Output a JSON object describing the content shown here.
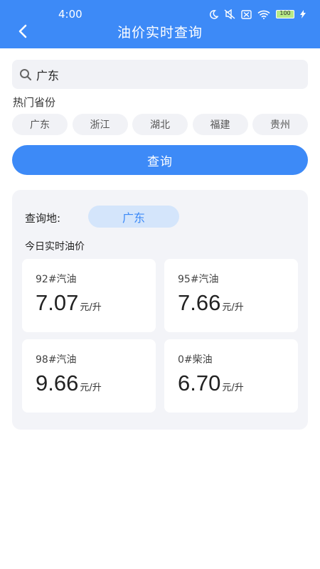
{
  "status_bar": {
    "time": "4:00",
    "battery": "100",
    "icons": [
      "moon-icon",
      "mute-icon",
      "sim-off-icon",
      "wifi-icon",
      "battery-icon",
      "charging-icon"
    ]
  },
  "header": {
    "title": "油价实时查询",
    "back_icon": "chevron-left-icon"
  },
  "search": {
    "value": "广东",
    "icon": "search-icon"
  },
  "hot_provinces": {
    "label": "热门省份",
    "items": [
      "广东",
      "浙江",
      "湖北",
      "福建",
      "贵州"
    ]
  },
  "query_button": {
    "label": "查询"
  },
  "result": {
    "location_label": "查询地:",
    "location_value": "广东",
    "today_label": "今日实时油价",
    "prices": [
      {
        "name": "92#汽油",
        "value": "7.07",
        "unit": "元/升"
      },
      {
        "name": "95#汽油",
        "value": "7.66",
        "unit": "元/升"
      },
      {
        "name": "98#汽油",
        "value": "9.66",
        "unit": "元/升"
      },
      {
        "name": "0#柴油",
        "value": "6.70",
        "unit": "元/升"
      }
    ]
  },
  "colors": {
    "primary": "#3d8af7",
    "chip_bg": "#f1f2f6",
    "card_bg": "#f3f4f8",
    "badge_bg": "#d4e5fb"
  }
}
